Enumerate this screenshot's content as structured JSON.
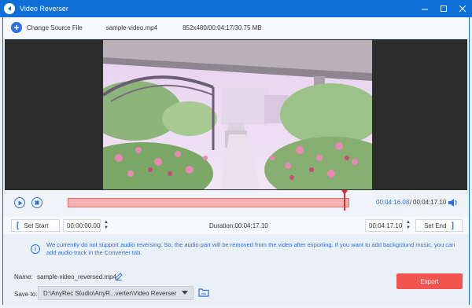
{
  "window": {
    "title": "Video Reverser"
  },
  "file": {
    "change_source_label": "Change Source File",
    "name": "sample-video.mp4",
    "info": "852x480/00:04:17/30.75 MB"
  },
  "player": {
    "current_time": "00:04:16.08",
    "separator": "/",
    "total_time": "00:04:17.10",
    "progress_fraction": 0.997
  },
  "trim": {
    "set_start_label": "Set Start",
    "start_value": "00:00:00.00",
    "duration_text": "Duration:00:04:17.10",
    "end_value": "00:04:17.10",
    "set_end_label": "Set End"
  },
  "notice": {
    "message": "We currently do not support audio reversing. So, the audio part will be removed from the video after exporting. If you want to add background music, you can add audio track in the Converter tab."
  },
  "output": {
    "name_label": "Name:",
    "name_value": "sample-video_reversed.mp4",
    "save_to_label": "Save to:",
    "save_to_value": "D:\\AnyRec Studio\\AnyR...verter\\Video Reverser",
    "export_label": "Export"
  },
  "colors": {
    "accent": "#2f6fe0",
    "titlebar": "#0f6fd8",
    "timeline_fill": "#f7b3b3",
    "playhead": "#d9312a",
    "export_button": "#f0554f"
  }
}
